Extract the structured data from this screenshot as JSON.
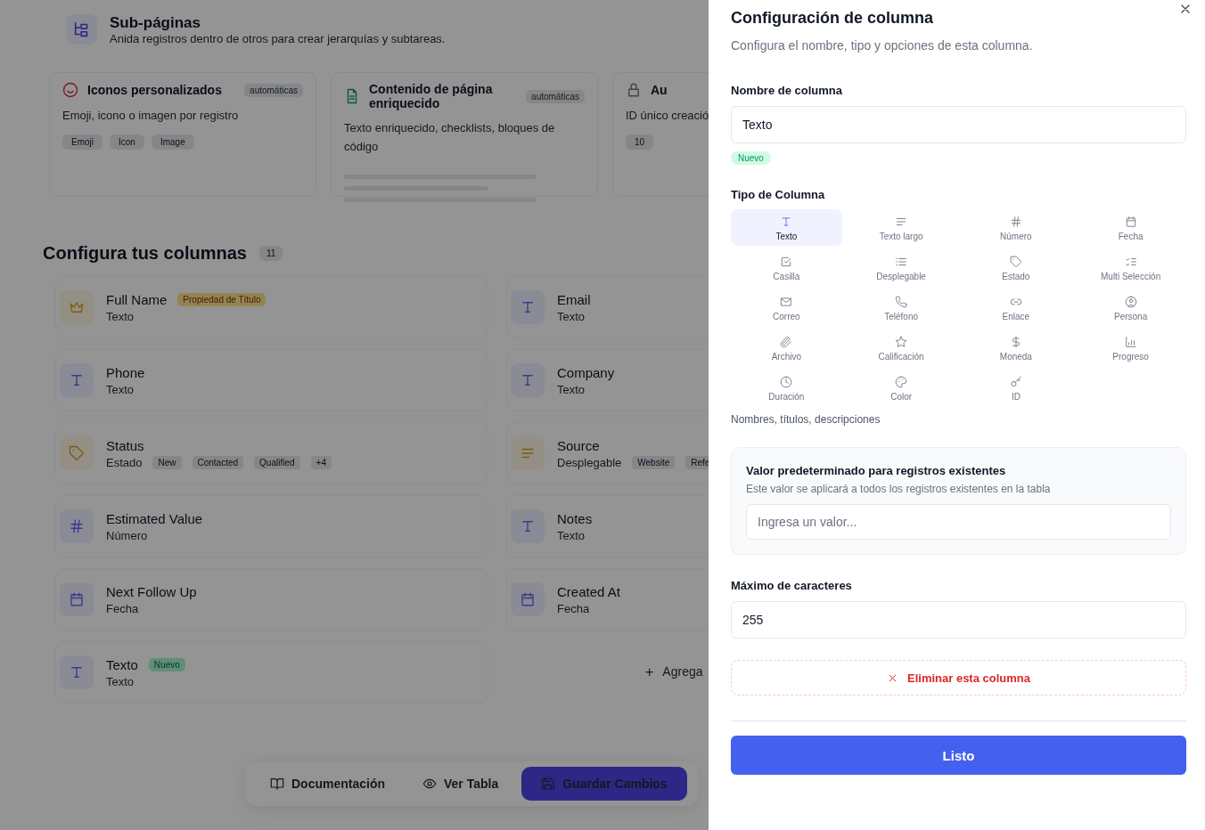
{
  "page": {
    "subpages": {
      "title": "Sub-páginas",
      "description": "Anida registros dentro de otros para crear jerarquías y subtareas."
    },
    "feature_cards": [
      {
        "title": "Iconos personalizados",
        "badge": "automáticas",
        "description": "Emoji, icono o imagen por registro",
        "chips": [
          "Emoji",
          "Icon",
          "Image"
        ],
        "kind": "icons"
      },
      {
        "title": "Contenido de página enriquecido",
        "badge": "automáticas",
        "description": "Texto enriquecido, checklists, bloques de código",
        "kind": "content"
      },
      {
        "title": "Au",
        "description": "ID único creació",
        "chips": [
          "10"
        ],
        "kind": "id"
      }
    ],
    "columns_section": {
      "title": "Configura tus columnas",
      "count": "11"
    },
    "columns": [
      {
        "name": "Full Name",
        "type": "Texto",
        "kind": "title",
        "badge": {
          "text": "Propiedad de Título",
          "kind": "title"
        }
      },
      {
        "name": "Email",
        "type": "Texto",
        "kind": "text"
      },
      {
        "name": "Phone",
        "type": "Texto",
        "kind": "text"
      },
      {
        "name": "Company",
        "type": "Texto",
        "kind": "text"
      },
      {
        "name": "Status",
        "type": "Estado",
        "kind": "status",
        "chips": [
          "New",
          "Contacted",
          "Qualified",
          "+4"
        ]
      },
      {
        "name": "Source",
        "type": "Desplegable",
        "kind": "dropdown",
        "chips": [
          "Website",
          "Refe"
        ]
      },
      {
        "name": "Estimated Value",
        "type": "Número",
        "kind": "number"
      },
      {
        "name": "Notes",
        "type": "Texto",
        "kind": "text"
      },
      {
        "name": "Next Follow Up",
        "type": "Fecha",
        "kind": "date"
      },
      {
        "name": "Created At",
        "type": "Fecha",
        "kind": "date"
      },
      {
        "name": "Texto",
        "type": "Texto",
        "kind": "text",
        "badge": {
          "text": "Nuevo",
          "kind": "new"
        }
      }
    ],
    "add_column": {
      "icon": "+",
      "label": "Agrega"
    },
    "bottom_bar": {
      "documentation": "Documentación",
      "view_table": "Ver Tabla",
      "save": "Guardar Cambios"
    }
  },
  "panel": {
    "title": "Configuración de columna",
    "subtitle": "Configura el nombre, tipo y opciones de esta columna.",
    "name_label": "Nombre de columna",
    "name_value": "Texto",
    "name_badge": "Nuevo",
    "type_label": "Tipo de Columna",
    "types": [
      {
        "label": "Texto",
        "selected": true
      },
      {
        "label": "Texto largo",
        "selected": false
      },
      {
        "label": "Número",
        "selected": false
      },
      {
        "label": "Fecha",
        "selected": false
      },
      {
        "label": "Casilla",
        "selected": false
      },
      {
        "label": "Desplegable",
        "selected": false
      },
      {
        "label": "Estado",
        "selected": false
      },
      {
        "label": "Multi Selección",
        "selected": false
      },
      {
        "label": "Correo",
        "selected": false
      },
      {
        "label": "Teléfono",
        "selected": false
      },
      {
        "label": "Enlace",
        "selected": false
      },
      {
        "label": "Persona",
        "selected": false
      },
      {
        "label": "Archivo",
        "selected": false
      },
      {
        "label": "Calificación",
        "selected": false
      },
      {
        "label": "Moneda",
        "selected": false
      },
      {
        "label": "Progreso",
        "selected": false
      },
      {
        "label": "Duración",
        "selected": false
      },
      {
        "label": "Color",
        "selected": false
      },
      {
        "label": "ID",
        "selected": false
      }
    ],
    "type_hint": "Nombres, títulos, descripciones",
    "default_box": {
      "title": "Valor predeterminado para registros existentes",
      "description": "Este valor se aplicará a todos los registros existentes en la tabla",
      "placeholder": "Ingresa un valor..."
    },
    "max_label": "Máximo de caracteres",
    "max_value": "255",
    "delete": "Eliminar esta columna",
    "done": "Listo"
  }
}
